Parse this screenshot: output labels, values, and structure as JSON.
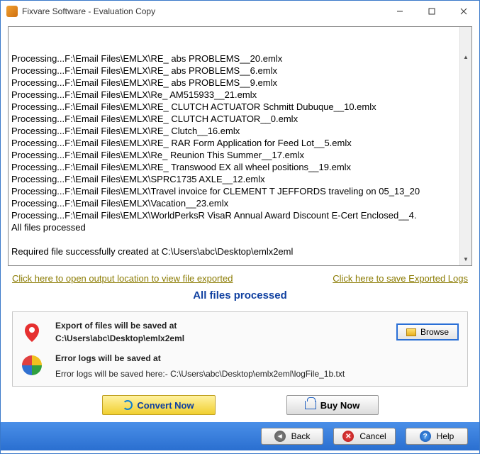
{
  "window": {
    "title": "Fixvare Software - Evaluation Copy"
  },
  "log_lines": [
    "Processing...F:\\Email Files\\EMLX\\RE_ abs PROBLEMS__20.emlx",
    "Processing...F:\\Email Files\\EMLX\\RE_ abs PROBLEMS__6.emlx",
    "Processing...F:\\Email Files\\EMLX\\RE_ abs PROBLEMS__9.emlx",
    "Processing...F:\\Email Files\\EMLX\\Re_ AM515933__21.emlx",
    "Processing...F:\\Email Files\\EMLX\\RE_ CLUTCH ACTUATOR Schmitt Dubuque__10.emlx",
    "Processing...F:\\Email Files\\EMLX\\RE_ CLUTCH ACTUATOR__0.emlx",
    "Processing...F:\\Email Files\\EMLX\\RE_ Clutch__16.emlx",
    "Processing...F:\\Email Files\\EMLX\\RE_ RAR Form Application for Feed Lot__5.emlx",
    "Processing...F:\\Email Files\\EMLX\\Re_ Reunion This Summer__17.emlx",
    "Processing...F:\\Email Files\\EMLX\\RE_ Transwood EX all wheel positions__19.emlx",
    "Processing...F:\\Email Files\\EMLX\\SPRC1735 AXLE__12.emlx",
    "Processing...F:\\Email Files\\EMLX\\Travel invoice for CLEMENT T JEFFORDS traveling on 05_13_20",
    "Processing...F:\\Email Files\\EMLX\\Vacation__23.emlx",
    "Processing...F:\\Email Files\\EMLX\\WorldPerksR VisaR Annual Award Discount E-Cert Enclosed__4.",
    "All files processed",
    "",
    "Required file successfully created at C:\\Users\\abc\\Desktop\\emlx2eml"
  ],
  "links": {
    "open_output": "Click here to open output location to view file exported",
    "save_logs": "Click here to save Exported Logs"
  },
  "status": "All files processed",
  "export": {
    "label": "Export of files will be saved at",
    "path": "C:\\Users\\abc\\Desktop\\emlx2eml",
    "browse": "Browse"
  },
  "errorlog": {
    "label": "Error logs will be saved at",
    "detail": "Error logs will be saved here:- C:\\Users\\abc\\Desktop\\emlx2eml\\logFile_1b.txt"
  },
  "actions": {
    "convert": "Convert Now",
    "buy": "Buy Now"
  },
  "nav": {
    "back": "Back",
    "cancel": "Cancel",
    "help": "Help"
  }
}
